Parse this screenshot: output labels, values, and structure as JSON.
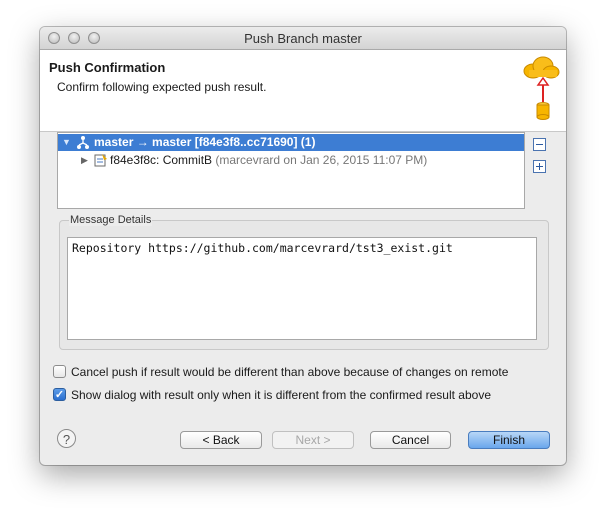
{
  "window": {
    "title": "Push Branch master"
  },
  "header": {
    "title": "Push Confirmation",
    "description": "Confirm following expected push result."
  },
  "tree": {
    "rows": [
      {
        "label": "master → master [f84e3f8..cc71690] (1)",
        "selected": true,
        "expanded": true,
        "icon": "branch-icon"
      },
      {
        "label": "f84e3f8c: CommitB",
        "meta": "(marcevrard on Jan 26, 2015 11:07 PM)",
        "selected": false,
        "expanded": false,
        "icon": "commit-icon"
      }
    ]
  },
  "message": {
    "label": "Message Details",
    "text": "Repository https://github.com/marcevrard/tst3_exist.git"
  },
  "options": [
    {
      "label": "Cancel push if result would be different than above because of changes on remote",
      "checked": false
    },
    {
      "label": "Show dialog with result only when it is different from the confirmed result above",
      "checked": true
    }
  ],
  "buttons": {
    "back": "< Back",
    "next": "Next >",
    "cancel": "Cancel",
    "finish": "Finish"
  },
  "help_glyph": "?",
  "colors": {
    "selection": "#3d7dd3",
    "default_button": "#6aa6ec"
  }
}
